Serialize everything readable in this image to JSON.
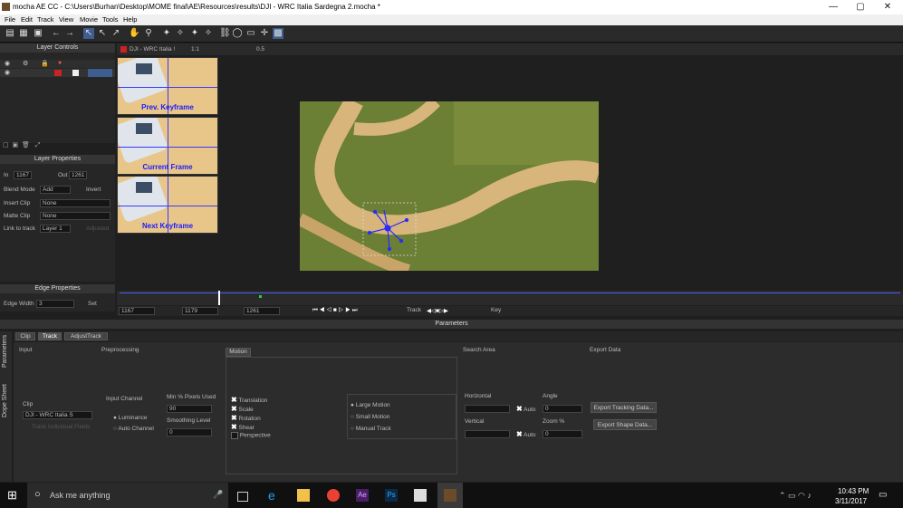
{
  "window": {
    "title": "mocha AE CC - C:\\Users\\Burhan\\Desktop\\MOME final\\AE\\Resources\\results\\DJI - WRC Italia Sardegna 2.mocha *"
  },
  "menu": [
    "File",
    "Edit",
    "Track",
    "View",
    "Movie",
    "Tools",
    "Help"
  ],
  "layer_controls": {
    "title": "Layer Controls"
  },
  "viewer": {
    "clip_label": "DJI - WRC Italia !",
    "zoom": "1:1",
    "opacity": "0.5"
  },
  "keyframes": {
    "prev": "Prev. Keyframe",
    "current": "Current Frame",
    "next": "Next Keyframe"
  },
  "layer_properties": {
    "title": "Layer Properties",
    "in_label": "In",
    "in_value": "1167",
    "out_label": "Out",
    "out_value": "1261",
    "blend_mode_label": "Blend Mode",
    "blend_mode_value": "Add",
    "invert_label": "Invert",
    "insert_clip_label": "Insert Clip",
    "insert_clip_value": "None",
    "matte_clip_label": "Matte Clip",
    "matte_clip_value": "None",
    "link_label": "Link to track",
    "link_value": "Layer 1",
    "adjusted_label": "Adjusted"
  },
  "edge_properties": {
    "title": "Edge Properties",
    "edge_width_label": "Edge Width",
    "edge_width_value": "3",
    "set_label": "Set"
  },
  "timeline": {
    "start": "1167",
    "current": "1179",
    "end": "1261",
    "track_label": "Track",
    "key_label": "Key"
  },
  "parameters": {
    "title": "Parameters",
    "tabs": [
      "Clip",
      "Track",
      "AdjustTrack"
    ],
    "side_tabs": [
      "Parameters",
      "Dope Sheet"
    ],
    "input": {
      "title": "Input",
      "clip_label": "Clip",
      "clip_value": "DJI - WRC Italia S",
      "track_individual": "Track Individual Fields"
    },
    "preprocessing": {
      "title": "Preprocessing",
      "input_channel_label": "Input Channel",
      "luminance": "Luminance",
      "auto_channel": "Auto Channel",
      "min_pixels_label": "Min % Pixels Used",
      "min_pixels_value": "90",
      "smoothing_label": "Smoothing Level",
      "smoothing_value": "0"
    },
    "motion": {
      "title": "Motion",
      "options": [
        "Translation",
        "Scale",
        "Rotation",
        "Shear",
        "Perspective"
      ],
      "modes": [
        "Large Motion",
        "Small Motion",
        "Manual Track"
      ]
    },
    "search_area": {
      "title": "Search Area",
      "horizontal_label": "Horizontal",
      "vertical_label": "Vertical",
      "auto_label": "Auto",
      "angle_label": "Angle",
      "angle_value": "0",
      "zoom_label": "Zoom %",
      "zoom_value": "0"
    },
    "export_data": {
      "title": "Export Data",
      "tracking_button": "Export Tracking Data...",
      "shape_button": "Export Shape Data..."
    }
  },
  "taskbar": {
    "search_placeholder": "Ask me anything",
    "time": "10:43 PM",
    "date": "3/11/2017"
  }
}
